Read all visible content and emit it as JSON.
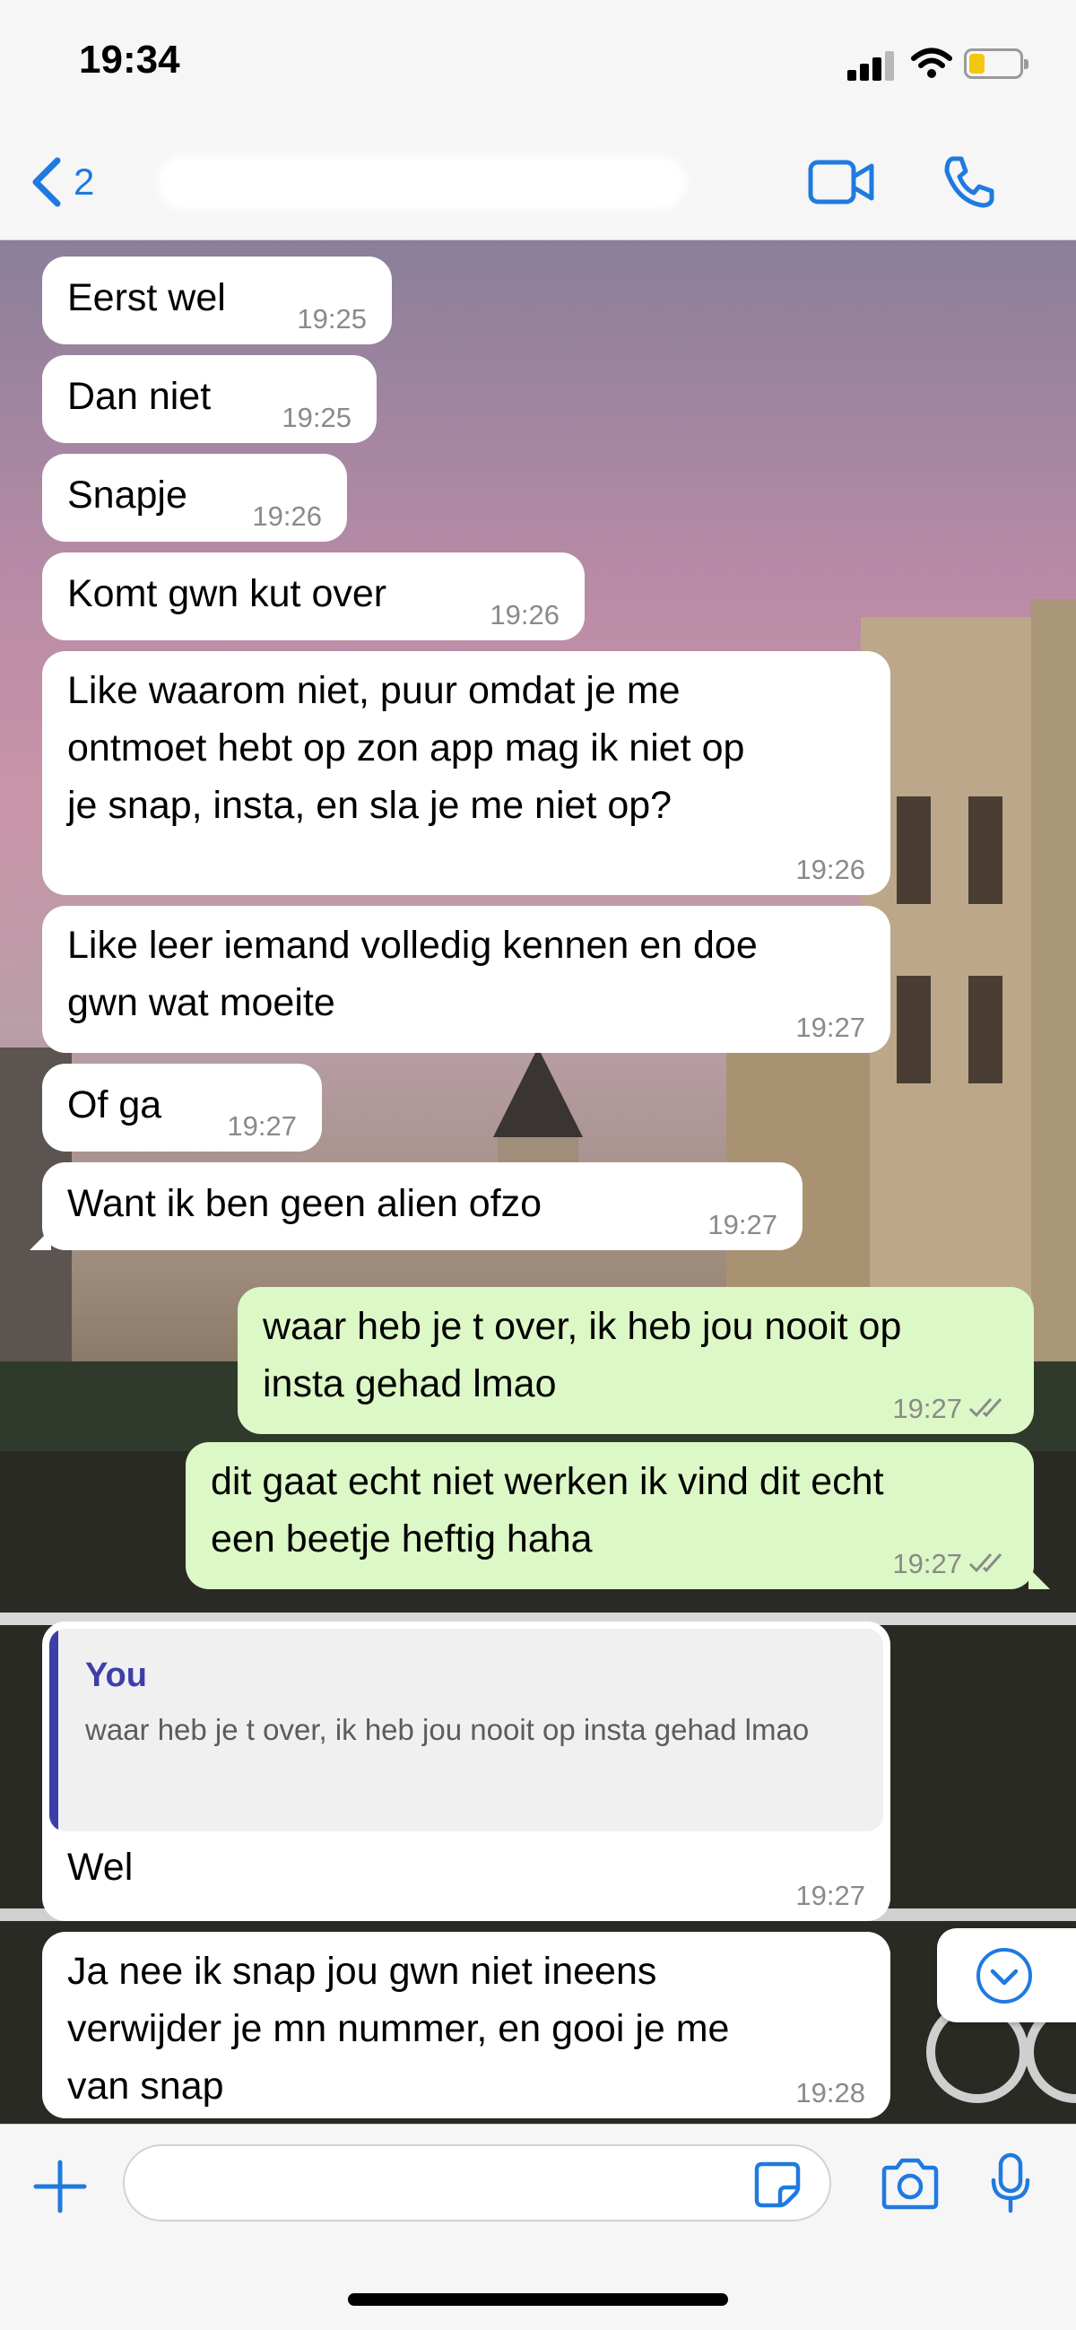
{
  "status_bar": {
    "time": "19:34",
    "battery_color": "#f2c80f"
  },
  "header": {
    "back_count": "2",
    "accent": "#1f7ae0"
  },
  "messages": [
    {
      "dir": "in",
      "text": "Eerst wel",
      "time": "19:25"
    },
    {
      "dir": "in",
      "text": "Dan niet",
      "time": "19:25"
    },
    {
      "dir": "in",
      "text": "Snapje",
      "time": "19:26"
    },
    {
      "dir": "in",
      "text": "Komt gwn kut over",
      "time": "19:26"
    },
    {
      "dir": "in",
      "text": "Like waarom niet, puur omdat je me\nontmoet hebt op zon app mag ik niet op\nje snap, insta, en sla je me niet op?",
      "time": "19:26"
    },
    {
      "dir": "in",
      "text": "Like leer iemand volledig kennen en doe\ngwn wat moeite",
      "time": "19:27"
    },
    {
      "dir": "in",
      "text": "Of ga",
      "time": "19:27"
    },
    {
      "dir": "in",
      "text": "Want ik ben geen alien ofzo",
      "time": "19:27"
    },
    {
      "dir": "out",
      "text": "waar heb je t over, ik heb jou nooit op\ninsta gehad lmao",
      "time": "19:27"
    },
    {
      "dir": "out",
      "text": "dit gaat echt niet werken ik vind dit echt\neen beetje heftig haha",
      "time": "19:27"
    },
    {
      "dir": "in",
      "quote_author": "You",
      "quote_text": "waar heb je t over, ik heb jou nooit op insta gehad lmao",
      "text": "Wel",
      "time": "19:27"
    },
    {
      "dir": "in",
      "text": "Ja nee ik snap jou gwn niet ineens\nverwijder je mn nummer, en gooi je me\nvan snap",
      "time": "19:28"
    }
  ],
  "input": {
    "value": "",
    "placeholder": ""
  },
  "colors": {
    "incoming_bubble": "#ffffff",
    "outgoing_bubble": "#dcf8c6",
    "quote_accent": "#3d3fa8",
    "icon": "#1f7ae0"
  },
  "icons": [
    "chevron-left-icon",
    "video-icon",
    "phone-icon",
    "chevron-down-circle-icon",
    "plus-icon",
    "sticker-icon",
    "camera-icon",
    "microphone-icon"
  ]
}
